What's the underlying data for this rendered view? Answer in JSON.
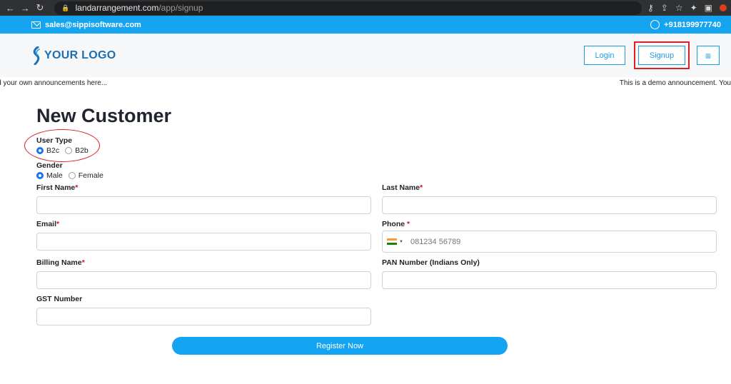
{
  "browser": {
    "url_domain": "landarrangement.com",
    "url_path": "/app/signup"
  },
  "contact": {
    "email": "sales@sippisoftware.com",
    "phone": "+918199977740"
  },
  "header": {
    "logo_text": "YOUR LOGO",
    "login_label": "Login",
    "signup_label": "Signup",
    "menu_glyph": "≡"
  },
  "announcements": {
    "left": "ld your own announcements here...",
    "right": "This is a demo announcement. You"
  },
  "form": {
    "title": "New Customer",
    "user_type": {
      "label": "User Type",
      "options": [
        "B2c",
        "B2b"
      ],
      "selected": "B2c"
    },
    "gender": {
      "label": "Gender",
      "options": [
        "Male",
        "Female"
      ],
      "selected": "Male"
    },
    "fields": {
      "first_name": {
        "label": "First Name",
        "required_mark": "*",
        "value": ""
      },
      "last_name": {
        "label": "Last Name",
        "required_mark": "*",
        "value": ""
      },
      "email": {
        "label": "Email",
        "required_mark": "*",
        "value": ""
      },
      "phone": {
        "label": "Phone ",
        "required_mark": "*",
        "placeholder": "081234 56789",
        "country": "IN"
      },
      "billing_name": {
        "label": "Billing Name",
        "required_mark": "*",
        "value": ""
      },
      "pan_number": {
        "label": "PAN Number (Indians Only)",
        "value": ""
      },
      "gst_number": {
        "label": "GST Number",
        "value": ""
      }
    },
    "register_label": "Register Now"
  },
  "colors": {
    "brand_blue": "#15a5f0",
    "logo_blue": "#1c6fb0",
    "highlight_red": "#e02020",
    "required_red": "#d0141c"
  }
}
